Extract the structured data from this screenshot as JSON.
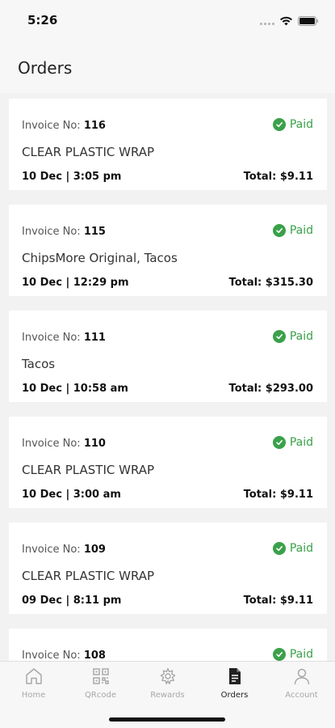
{
  "status_bar": {
    "time": "5:26"
  },
  "header": {
    "title": "Orders"
  },
  "orders": [
    {
      "invoice_label": "Invoice No:",
      "invoice_no": "116",
      "status": "Paid",
      "items": "CLEAR PLASTIC WRAP",
      "date": "10 Dec | 3:05 pm",
      "total": "Total: $9.11"
    },
    {
      "invoice_label": "Invoice No:",
      "invoice_no": "115",
      "status": "Paid",
      "items": "ChipsMore Original, Tacos",
      "date": "10 Dec | 12:29 pm",
      "total": "Total: $315.30"
    },
    {
      "invoice_label": "Invoice No:",
      "invoice_no": "111",
      "status": "Paid",
      "items": "Tacos",
      "date": "10 Dec | 10:58 am",
      "total": "Total: $293.00"
    },
    {
      "invoice_label": "Invoice No:",
      "invoice_no": "110",
      "status": "Paid",
      "items": "CLEAR PLASTIC WRAP",
      "date": "10 Dec | 3:00 am",
      "total": "Total: $9.11"
    },
    {
      "invoice_label": "Invoice No:",
      "invoice_no": "109",
      "status": "Paid",
      "items": "CLEAR PLASTIC WRAP",
      "date": "09 Dec | 8:11 pm",
      "total": "Total: $9.11"
    },
    {
      "invoice_label": "Invoice No:",
      "invoice_no": "108",
      "status": "Paid",
      "items": "",
      "date": "",
      "total": ""
    }
  ],
  "tabs": [
    {
      "label": "Home",
      "icon": "home-icon",
      "active": false
    },
    {
      "label": "QRcode",
      "icon": "qrcode-icon",
      "active": false
    },
    {
      "label": "Rewards",
      "icon": "rewards-icon",
      "active": false
    },
    {
      "label": "Orders",
      "icon": "orders-icon",
      "active": true
    },
    {
      "label": "Account",
      "icon": "account-icon",
      "active": false
    }
  ],
  "colors": {
    "paid": "#3aa14a",
    "background": "#f2f2f2",
    "card": "#ffffff",
    "tab_inactive": "#a8a8a8",
    "tab_active": "#222222"
  }
}
